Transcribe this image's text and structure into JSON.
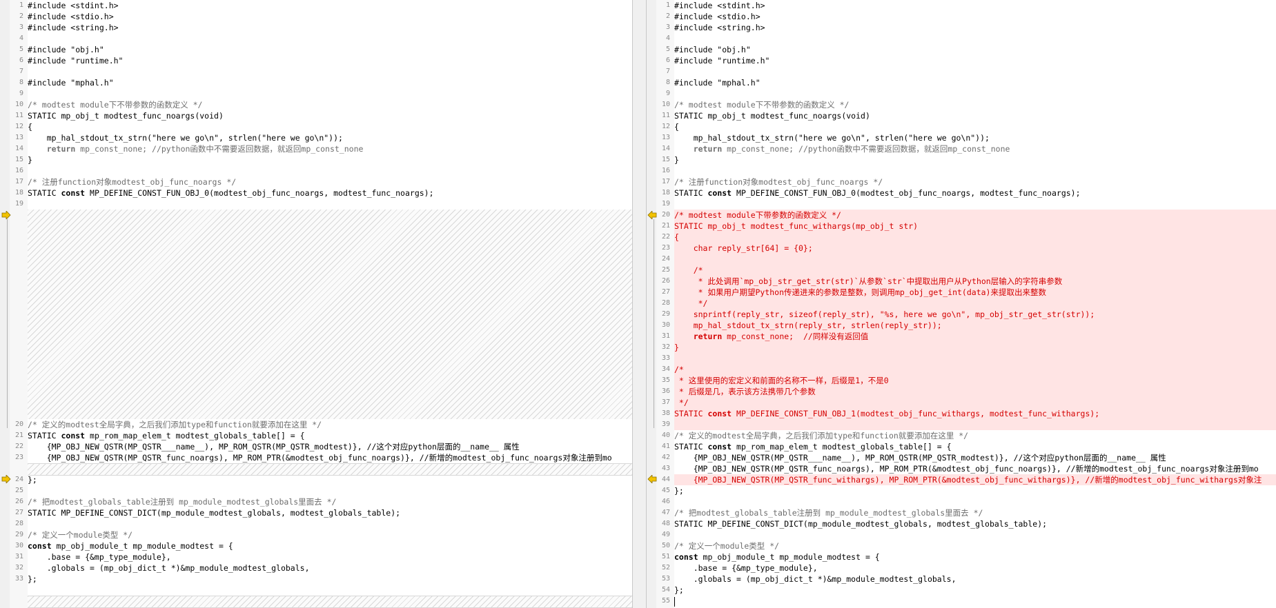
{
  "colors": {
    "changed_text": "#d40000",
    "changed_bg": "#ffe4e4",
    "comment": "#6e6e6e",
    "marker_arrow": "#f2c200"
  },
  "icons": {
    "left_marker": "right-arrow-diff-icon",
    "right_marker": "left-arrow-diff-icon"
  },
  "left": {
    "lines": [
      {
        "n": "1",
        "t": "#include <stdint.h>"
      },
      {
        "n": "2",
        "t": "#include <stdio.h>"
      },
      {
        "n": "3",
        "t": "#include <string.h>"
      },
      {
        "n": "4",
        "t": ""
      },
      {
        "n": "5",
        "t": "#include \"obj.h\""
      },
      {
        "n": "6",
        "t": "#include \"runtime.h\""
      },
      {
        "n": "7",
        "t": ""
      },
      {
        "n": "8",
        "t": "#include \"mphal.h\""
      },
      {
        "n": "9",
        "t": ""
      },
      {
        "n": "10",
        "t": "/* modtest module下不带参数的函数定义 */"
      },
      {
        "n": "11",
        "t": "STATIC mp_obj_t modtest_func_noargs(void)"
      },
      {
        "n": "12",
        "t": "{"
      },
      {
        "n": "13",
        "t": "    mp_hal_stdout_tx_strn(\"here we go\\n\", strlen(\"here we go\\n\"));"
      },
      {
        "n": "14",
        "t": "    return mp_const_none; //python函数中不需要返回数据，就返回mp_const_none"
      },
      {
        "n": "15",
        "t": "}"
      },
      {
        "n": "16",
        "t": ""
      },
      {
        "n": "17",
        "t": "/* 注册function对象modtest_obj_func_noargs */"
      },
      {
        "n": "18",
        "t": "STATIC const MP_DEFINE_CONST_FUN_OBJ_0(modtest_obj_func_noargs, modtest_func_noargs);"
      },
      {
        "n": "19",
        "t": ""
      },
      {
        "n": "20",
        "t": "/* 定义的modtest全局字典，之后我们添加type和function就要添加在这里 */"
      },
      {
        "n": "21",
        "t": "STATIC const mp_rom_map_elem_t modtest_globals_table[] = {"
      },
      {
        "n": "22",
        "t": "    {MP_OBJ_NEW_QSTR(MP_QSTR___name__), MP_ROM_QSTR(MP_QSTR_modtest)}, //这个对应python层面的__name__ 属性"
      },
      {
        "n": "23",
        "t": "    {MP_OBJ_NEW_QSTR(MP_QSTR_func_noargs), MP_ROM_PTR(&modtest_obj_func_noargs)}, //新增的modtest_obj_func_noargs对象注册到mo"
      },
      {
        "n": "24",
        "t": "};"
      },
      {
        "n": "25",
        "t": ""
      },
      {
        "n": "26",
        "t": "/* 把modtest_globals_table注册到 mp_module_modtest_globals里面去 */"
      },
      {
        "n": "27",
        "t": "STATIC MP_DEFINE_CONST_DICT(mp_module_modtest_globals, modtest_globals_table);"
      },
      {
        "n": "28",
        "t": ""
      },
      {
        "n": "29",
        "t": "/* 定义一个module类型 */"
      },
      {
        "n": "30",
        "t": "const mp_obj_module_t mp_module_modtest = {"
      },
      {
        "n": "31",
        "t": "    .base = {&mp_type_module},"
      },
      {
        "n": "32",
        "t": "    .globals = (mp_obj_dict_t *)&mp_module_modtest_globals,"
      },
      {
        "n": "33",
        "t": "};"
      }
    ]
  },
  "right": {
    "lines": [
      {
        "n": "1",
        "t": "#include <stdint.h>"
      },
      {
        "n": "2",
        "t": "#include <stdio.h>"
      },
      {
        "n": "3",
        "t": "#include <string.h>"
      },
      {
        "n": "4",
        "t": ""
      },
      {
        "n": "5",
        "t": "#include \"obj.h\""
      },
      {
        "n": "6",
        "t": "#include \"runtime.h\""
      },
      {
        "n": "7",
        "t": ""
      },
      {
        "n": "8",
        "t": "#include \"mphal.h\""
      },
      {
        "n": "9",
        "t": ""
      },
      {
        "n": "10",
        "t": "/* modtest module下不带参数的函数定义 */"
      },
      {
        "n": "11",
        "t": "STATIC mp_obj_t modtest_func_noargs(void)"
      },
      {
        "n": "12",
        "t": "{"
      },
      {
        "n": "13",
        "t": "    mp_hal_stdout_tx_strn(\"here we go\\n\", strlen(\"here we go\\n\"));"
      },
      {
        "n": "14",
        "t": "    return mp_const_none; //python函数中不需要返回数据，就返回mp_const_none"
      },
      {
        "n": "15",
        "t": "}"
      },
      {
        "n": "16",
        "t": ""
      },
      {
        "n": "17",
        "t": "/* 注册function对象modtest_obj_func_noargs */"
      },
      {
        "n": "18",
        "t": "STATIC const MP_DEFINE_CONST_FUN_OBJ_0(modtest_obj_func_noargs, modtest_func_noargs);"
      },
      {
        "n": "19",
        "t": ""
      },
      {
        "n": "20",
        "t": "/* modtest module下带参数的函数定义 */"
      },
      {
        "n": "21",
        "t": "STATIC mp_obj_t modtest_func_withargs(mp_obj_t str)"
      },
      {
        "n": "22",
        "t": "{"
      },
      {
        "n": "23",
        "t": "    char reply_str[64] = {0};"
      },
      {
        "n": "24",
        "t": ""
      },
      {
        "n": "25",
        "t": "    /*"
      },
      {
        "n": "26",
        "t": "     * 此处调用`mp_obj_str_get_str(str)`从参数`str`中提取出用户从Python层输入的字符串参数"
      },
      {
        "n": "27",
        "t": "     * 如果用户期望Python传递进来的参数是整数，则调用mp_obj_get_int(data)来提取出来整数"
      },
      {
        "n": "28",
        "t": "     */"
      },
      {
        "n": "29",
        "t": "    snprintf(reply_str, sizeof(reply_str), \"%s, here we go\\n\", mp_obj_str_get_str(str));"
      },
      {
        "n": "30",
        "t": "    mp_hal_stdout_tx_strn(reply_str, strlen(reply_str));"
      },
      {
        "n": "31",
        "t": "    return mp_const_none;  //同样没有返回值"
      },
      {
        "n": "32",
        "t": "}"
      },
      {
        "n": "33",
        "t": ""
      },
      {
        "n": "34",
        "t": "/*"
      },
      {
        "n": "35",
        "t": " * 这里使用的宏定义和前面的名称不一样，后缀是1，不是0"
      },
      {
        "n": "36",
        "t": " * 后缀是几，表示该方法携带几个参数"
      },
      {
        "n": "37",
        "t": " */"
      },
      {
        "n": "38",
        "t": "STATIC const MP_DEFINE_CONST_FUN_OBJ_1(modtest_obj_func_withargs, modtest_func_withargs);"
      },
      {
        "n": "39",
        "t": ""
      },
      {
        "n": "40",
        "t": "/* 定义的modtest全局字典，之后我们添加type和function就要添加在这里 */"
      },
      {
        "n": "41",
        "t": "STATIC const mp_rom_map_elem_t modtest_globals_table[] = {"
      },
      {
        "n": "42",
        "t": "    {MP_OBJ_NEW_QSTR(MP_QSTR___name__), MP_ROM_QSTR(MP_QSTR_modtest)}, //这个对应python层面的__name__ 属性"
      },
      {
        "n": "43",
        "t": "    {MP_OBJ_NEW_QSTR(MP_QSTR_func_noargs), MP_ROM_PTR(&modtest_obj_func_noargs)}, //新增的modtest_obj_func_noargs对象注册到mo"
      },
      {
        "n": "44",
        "t": "    {MP_OBJ_NEW_QSTR(MP_QSTR_func_withargs), MP_ROM_PTR(&modtest_obj_func_withargs)}, //新增的modtest_obj_func_withargs对象注"
      },
      {
        "n": "45",
        "t": "};"
      },
      {
        "n": "46",
        "t": ""
      },
      {
        "n": "47",
        "t": "/* 把modtest_globals_table注册到 mp_module_modtest_globals里面去 */"
      },
      {
        "n": "48",
        "t": "STATIC MP_DEFINE_CONST_DICT(mp_module_modtest_globals, modtest_globals_table);"
      },
      {
        "n": "49",
        "t": ""
      },
      {
        "n": "50",
        "t": "/* 定义一个module类型 */"
      },
      {
        "n": "51",
        "t": "const mp_obj_module_t mp_module_modtest = {"
      },
      {
        "n": "52",
        "t": "    .base = {&mp_type_module},"
      },
      {
        "n": "53",
        "t": "    .globals = (mp_obj_dict_t *)&mp_module_modtest_globals,"
      },
      {
        "n": "54",
        "t": "};"
      },
      {
        "n": "55",
        "t": ""
      }
    ]
  }
}
